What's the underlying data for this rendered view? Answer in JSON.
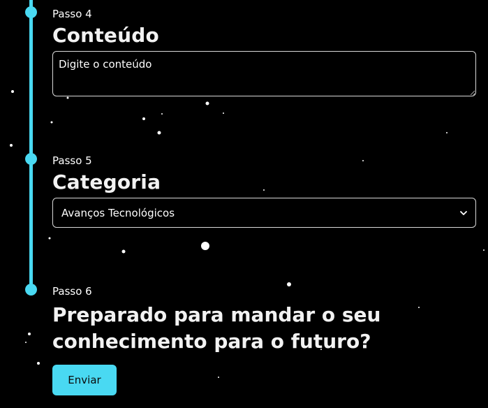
{
  "colors": {
    "accent": "#49d9f2",
    "background": "#000000",
    "text": "#ffffff"
  },
  "steps": [
    {
      "label": "Passo 4",
      "title": "Conteúdo"
    },
    {
      "label": "Passo 5",
      "title": "Categoria"
    },
    {
      "label": "Passo 6"
    }
  ],
  "content_field": {
    "placeholder": "Digite o conteúdo"
  },
  "category_select": {
    "selected": "Avanços Tecnológicos",
    "icon": "chevron-down-icon"
  },
  "final_step": {
    "headline_line1": "Preparado para mandar o seu",
    "headline_line2": "conhecimento para o futuro?"
  },
  "submit_button": {
    "label": "Enviar"
  }
}
